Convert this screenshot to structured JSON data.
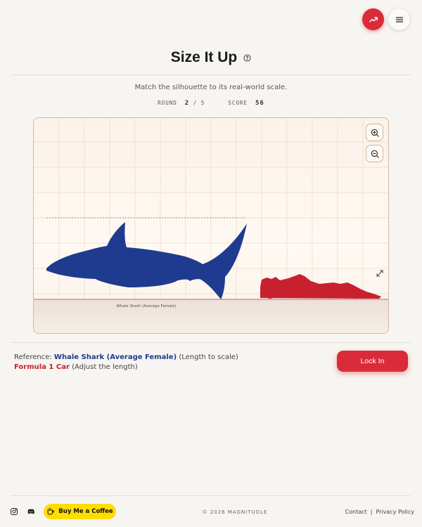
{
  "header": {
    "trend_icon": "trending-up-icon",
    "menu_icon": "menu-icon",
    "title": "Size It Up",
    "help_icon": "help-circle-icon"
  },
  "game": {
    "subtitle": "Match the silhouette to its real-world scale.",
    "round_label": "ROUND",
    "round_current": "2",
    "round_separator": "/",
    "round_total": "5",
    "score_label": "SCORE",
    "score_value": "56"
  },
  "stage": {
    "reference_caption": "Whale Shark (Average Female)",
    "reference_color": "#1f3b8f",
    "target_color": "#c8202e",
    "zoom_in_icon": "zoom-in-icon",
    "zoom_out_icon": "zoom-out-icon",
    "resize_icon": "expand-diagonal-icon"
  },
  "info": {
    "reference_prefix": "Reference:",
    "reference_name": "Whale Shark (Average Female)",
    "reference_note": "(Length to scale)",
    "target_name": "Formula 1 Car",
    "target_note": "(Adjust the length)"
  },
  "actions": {
    "lock_in": "Lock In"
  },
  "footer": {
    "coffee_label": "Buy Me a Coffee",
    "copyright": "© 2026 MAGNITUDLE",
    "contact": "Contact",
    "separator": "|",
    "privacy": "Privacy Policy"
  },
  "colors": {
    "accent": "#d92b3a",
    "background": "#f7f5f1",
    "coffee": "#ffdd00"
  }
}
